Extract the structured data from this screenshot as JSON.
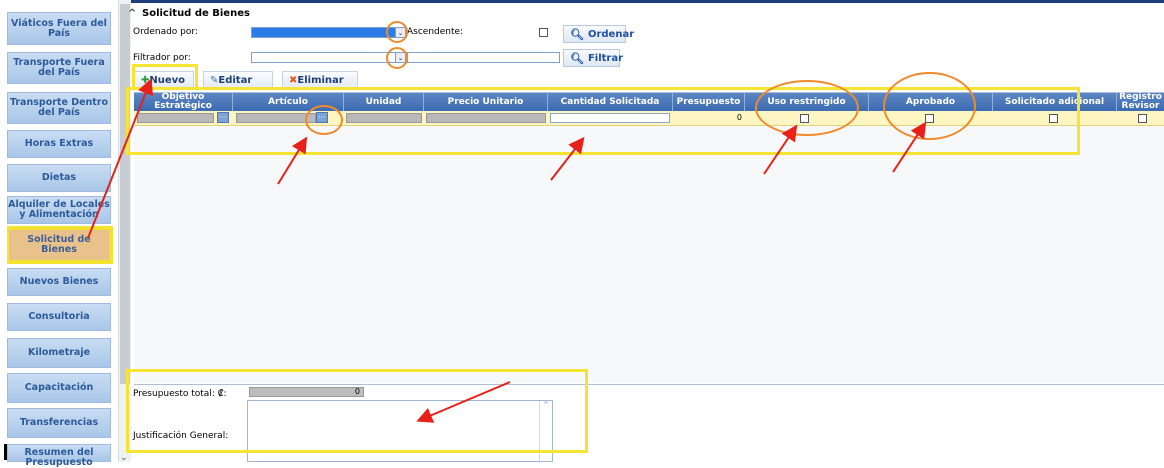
{
  "sidebar": {
    "items": [
      {
        "label": "Viáticos Fuera del País"
      },
      {
        "label": "Transporte Fuera del País"
      },
      {
        "label": "Transporte Dentro del País"
      },
      {
        "label": "Horas Extras"
      },
      {
        "label": "Dietas"
      },
      {
        "label": "Alquiler de Locales y Alimentación"
      },
      {
        "label": "Solicitud de Bienes",
        "active": true
      },
      {
        "label": "Nuevos Bienes"
      },
      {
        "label": "Consultoria"
      },
      {
        "label": "Kilometraje"
      },
      {
        "label": "Capacitación"
      },
      {
        "label": "Transferencias"
      },
      {
        "label": "Resumen del Presupuesto"
      }
    ]
  },
  "section": {
    "title": "Solicitud de Bienes"
  },
  "sort": {
    "label": "Ordenado por:",
    "ascending_label": "Ascendente:",
    "button": "Ordenar"
  },
  "filter": {
    "label": "Filtrador por:",
    "button": "Filtrar"
  },
  "toolbar": {
    "new": "Nuevo",
    "edit": "Editar",
    "delete": "Eliminar"
  },
  "grid": {
    "columns": [
      "Objetivo Estratégico",
      "Artículo",
      "Unidad",
      "Precio Unitario",
      "Cantidad Solicitada",
      "Presupuesto",
      "Uso restringido",
      "Aprobado",
      "Solicitado adicional",
      "Registro Revisor"
    ],
    "row": {
      "presupuesto": "0"
    }
  },
  "footer": {
    "total_label": "Presupuesto total: ₡:",
    "total_value": "0",
    "justification_label": "Justificación General:"
  },
  "colors": {
    "highlight_box": "#f5e431",
    "circle": "#f08a2a",
    "arrow": "#e8201a",
    "header": "#3c6bb2"
  }
}
